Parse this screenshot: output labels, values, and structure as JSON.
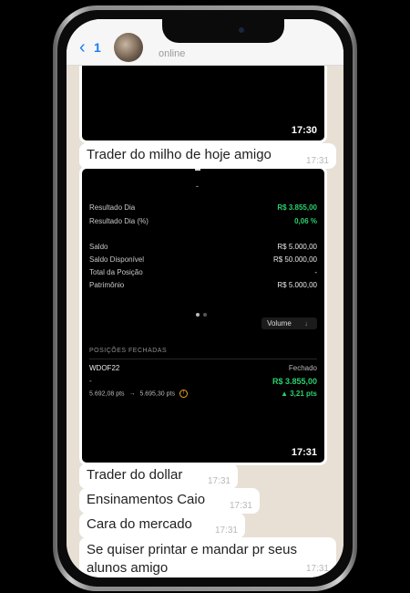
{
  "header": {
    "back_badge": "1",
    "status": "online"
  },
  "messages": {
    "image1_time": "17:30",
    "text1": "Trader do milho de hoje amigo",
    "text1_time": "17:31",
    "image2_time": "17:31",
    "text2": "Trader do dollar",
    "text2_time": "17:31",
    "text3": "Ensinamentos Caio",
    "text3_time": "17:31",
    "text4": "Cara do mercado",
    "text4_time": "17:31",
    "text5_line1": "Se quiser printar e mandar pr seus",
    "text5_line2": "alunos amigo",
    "text5_time": "17:31"
  },
  "report": {
    "top_dash": "-",
    "rows": [
      {
        "label": "Resultado Dia",
        "value": "R$ 3.855,00",
        "green": true
      },
      {
        "label": "Resultado Dia (%)",
        "value": "0,06 %",
        "green": true
      },
      {
        "label": "Saldo",
        "value": "R$ 5.000,00",
        "green": false
      },
      {
        "label": "Saldo Disponível",
        "value": "R$ 50.000,00",
        "green": false
      },
      {
        "label": "Total da Posição",
        "value": "-",
        "green": false
      },
      {
        "label": "Patrimônio",
        "value": "R$ 5.000,00",
        "green": false
      }
    ],
    "volume_label": "Volume",
    "volume_arrow": "↓",
    "section_title": "POSIÇÕES FECHADAS",
    "asset": "WDOF22",
    "asset_status": "Fechado",
    "dash": "-",
    "result_value": "R$ 3.855,00",
    "pts_from": "5.692,08 pts",
    "arrow": "→",
    "pts_to": "5.695,30 pts",
    "delta": "▲ 3,21 pts"
  },
  "colors": {
    "accent_blue": "#1e7cf5",
    "profit_green": "#2ad06f",
    "warning_orange": "#f0a020"
  }
}
